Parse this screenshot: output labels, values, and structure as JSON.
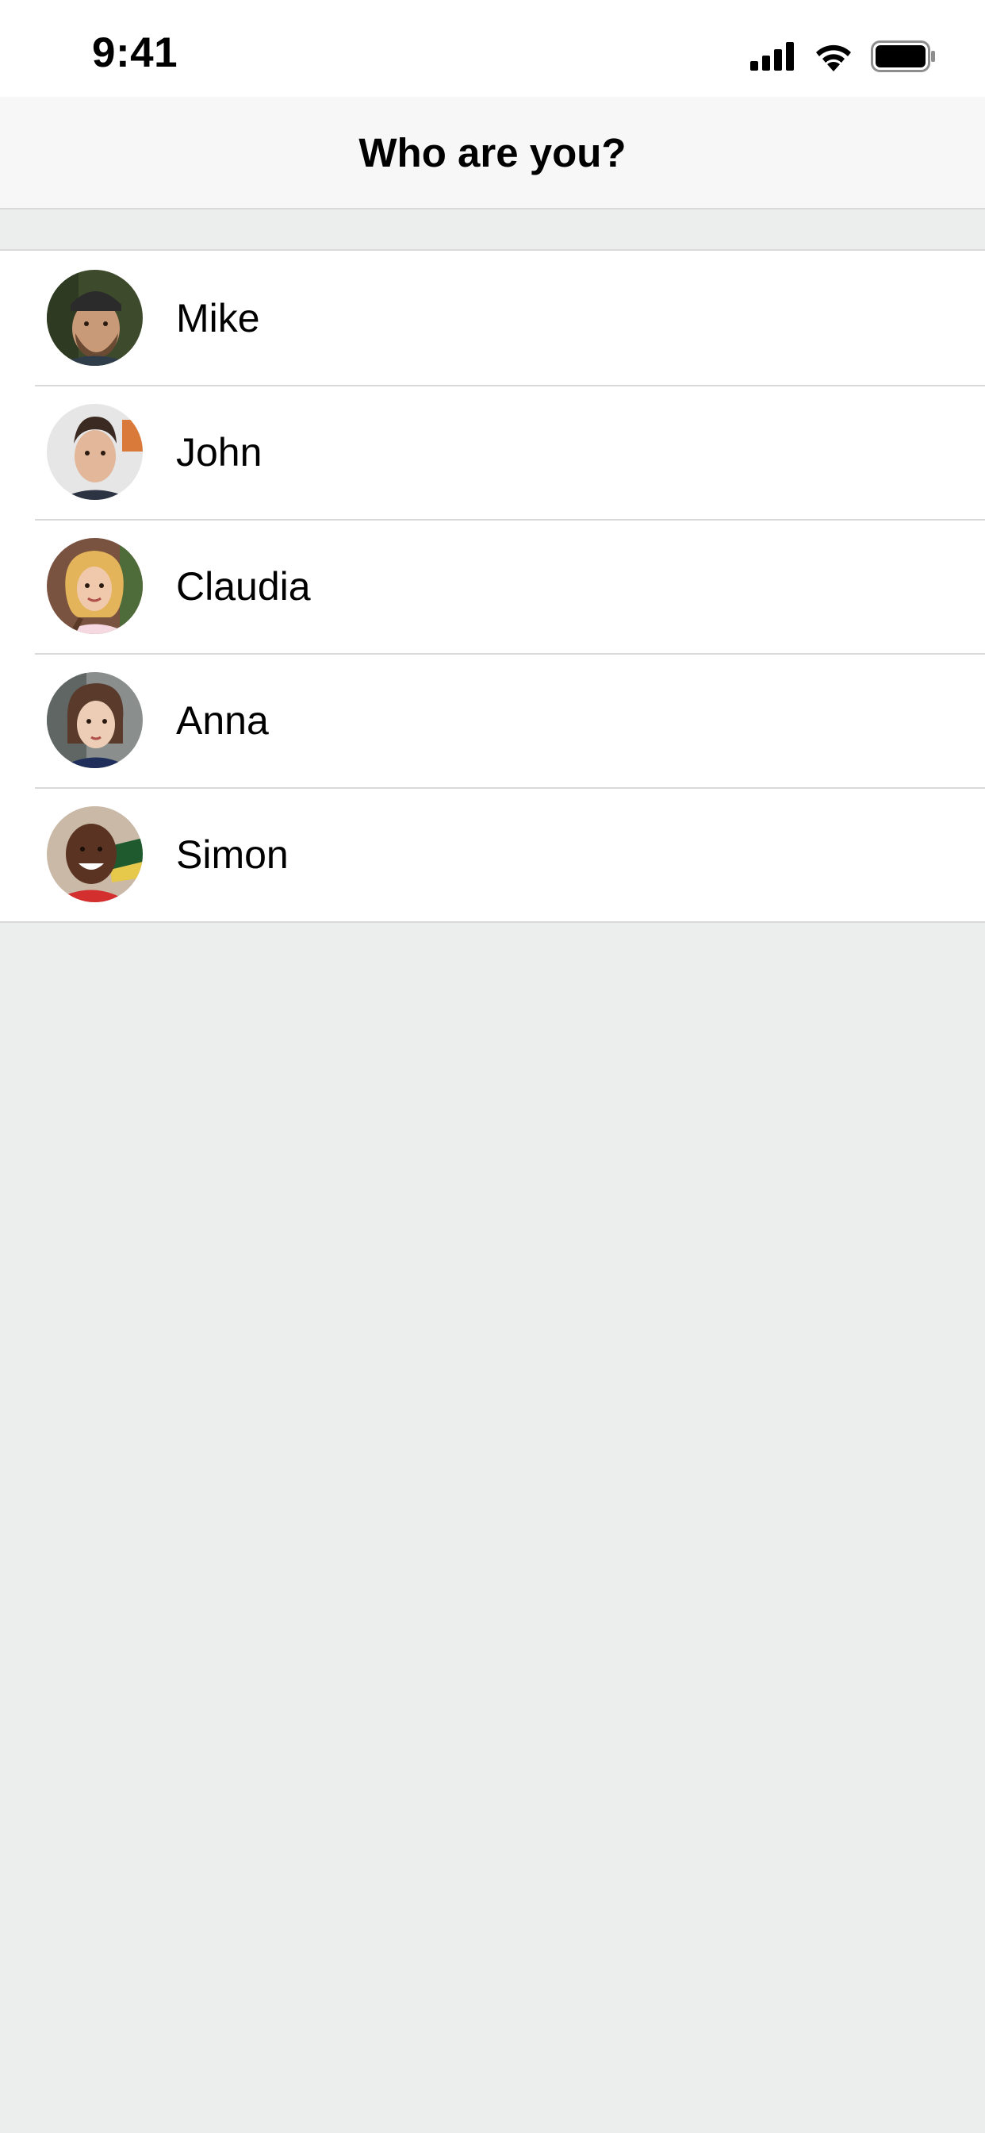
{
  "status_bar": {
    "time": "9:41",
    "icons": [
      "cellular-signal-icon",
      "wifi-icon",
      "battery-icon"
    ]
  },
  "nav": {
    "title": "Who are you?"
  },
  "users": [
    {
      "name": "Mike",
      "avatar": "avatar-mike"
    },
    {
      "name": "John",
      "avatar": "avatar-john"
    },
    {
      "name": "Claudia",
      "avatar": "avatar-claudia"
    },
    {
      "name": "Anna",
      "avatar": "avatar-anna"
    },
    {
      "name": "Simon",
      "avatar": "avatar-simon"
    }
  ],
  "colors": {
    "background": "#ECEDED",
    "nav_background": "#F7F7F7",
    "list_background": "#FFFFFF",
    "separator": "#D9D9D9",
    "text": "#000000"
  }
}
